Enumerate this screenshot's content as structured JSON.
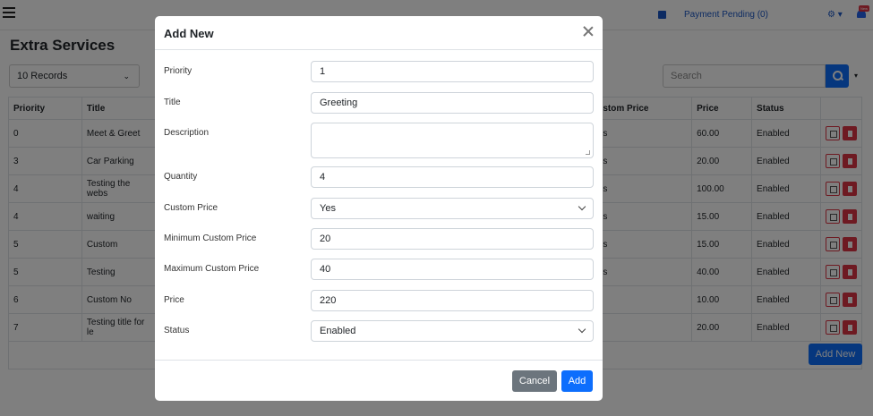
{
  "topbar": {
    "payment_label": "Payment Pending (0)",
    "gear_label": "⚙ ▾",
    "notif_badge": "New"
  },
  "page": {
    "title": "Extra Services",
    "records_select": "10 Records",
    "search_placeholder": "Search",
    "add_new_label": "Add New"
  },
  "table": {
    "headers": [
      "Priority",
      "Title",
      "",
      "stom Price",
      "Price",
      "Status",
      ""
    ],
    "rows": [
      {
        "priority": "0",
        "title": "Meet & Greet",
        "cp": "s",
        "price": "60.00",
        "status": "Enabled"
      },
      {
        "priority": "3",
        "title": "Car Parking",
        "cp": "s",
        "price": "20.00",
        "status": "Enabled"
      },
      {
        "priority": "4",
        "title": "Testing the webs",
        "cp": "s",
        "price": "100.00",
        "status": "Enabled"
      },
      {
        "priority": "4",
        "title": "waiting",
        "cp": "s",
        "price": "15.00",
        "status": "Enabled"
      },
      {
        "priority": "5",
        "title": "Custom",
        "cp": "s",
        "price": "15.00",
        "status": "Enabled"
      },
      {
        "priority": "5",
        "title": "Testing",
        "cp": "s",
        "price": "40.00",
        "status": "Enabled"
      },
      {
        "priority": "6",
        "title": "Custom No",
        "cp": "",
        "price": "10.00",
        "status": "Enabled"
      },
      {
        "priority": "7",
        "title": "Testing title for le",
        "cp": "",
        "price": "20.00",
        "status": "Enabled"
      }
    ]
  },
  "modal": {
    "title": "Add New",
    "fields": [
      {
        "label": "Priority",
        "value": "1"
      },
      {
        "label": "Title",
        "value": "Greeting"
      },
      {
        "label": "Description",
        "value": ""
      },
      {
        "label": "Quantity",
        "value": "4"
      },
      {
        "label": "Custom Price",
        "value": "Yes"
      },
      {
        "label": "Minimum Custom Price",
        "value": "20"
      },
      {
        "label": "Maximum Custom Price",
        "value": "40"
      },
      {
        "label": "Price",
        "value": "220"
      },
      {
        "label": "Status",
        "value": "Enabled"
      }
    ],
    "cancel_label": "Cancel",
    "add_label": "Add"
  },
  "colors": {
    "primary": "#0d6efd",
    "secondary": "#6c757d",
    "danger": "#dc3545"
  }
}
